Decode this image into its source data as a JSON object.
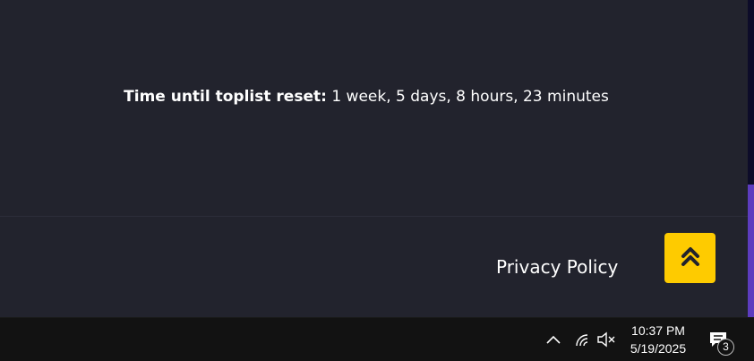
{
  "toplist": {
    "reset_label": "Time until toplist reset:",
    "reset_value": " 1 week, 5 days, 8 hours, 23 minutes"
  },
  "footer": {
    "privacy_label": "Privacy Policy"
  },
  "colors": {
    "background": "#22232d",
    "accent_button": "#fecb00",
    "scroll_thumb": "#5c3cbf",
    "taskbar": "#121212"
  },
  "taskbar": {
    "time": "10:37 PM",
    "date": "5/19/2025",
    "notification_count": "3",
    "icons": [
      "chevron-up-icon",
      "wifi-icon",
      "volume-muted-icon",
      "notification-icon"
    ]
  }
}
